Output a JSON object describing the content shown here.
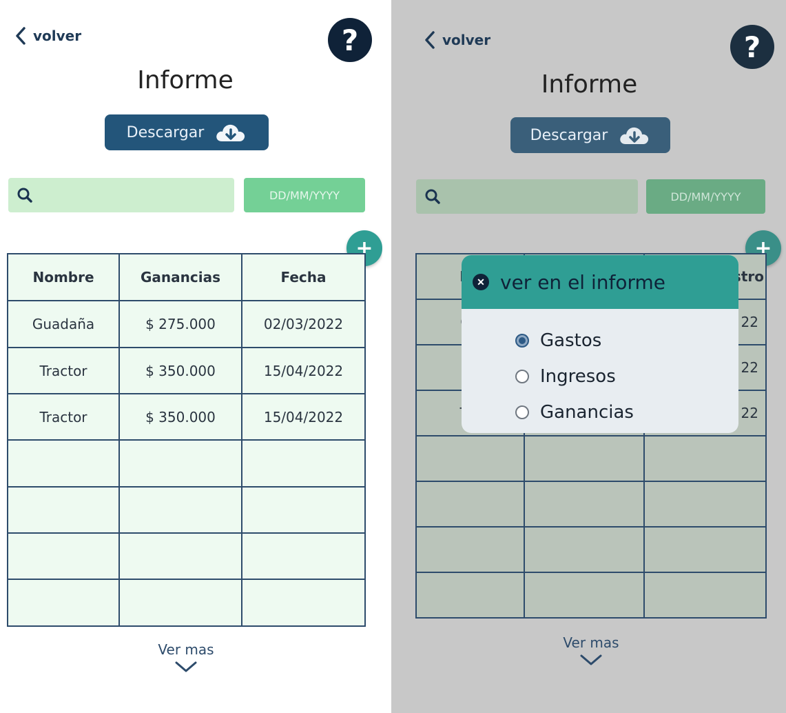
{
  "left": {
    "back_label": "volver",
    "help_label": "?",
    "title": "Informe",
    "download_label": "Descargar",
    "search_placeholder": "",
    "date_placeholder": "DD/MM/YYYY",
    "add_label": "+",
    "table": {
      "headers": [
        "Nombre",
        "Ganancias",
        "Fecha"
      ],
      "rows": [
        [
          "Guadaña",
          "$ 275.000",
          "02/03/2022"
        ],
        [
          "Tractor",
          "$ 350.000",
          "15/04/2022"
        ],
        [
          "Tractor",
          "$ 350.000",
          "15/04/2022"
        ],
        [
          "",
          "",
          ""
        ],
        [
          "",
          "",
          ""
        ],
        [
          "",
          "",
          ""
        ],
        [
          "",
          "",
          ""
        ]
      ]
    },
    "see_more_label": "Ver mas"
  },
  "right": {
    "back_label": "volver",
    "help_label": "?",
    "title": "Informe",
    "download_label": "Descargar",
    "search_placeholder": "",
    "date_placeholder": "DD/MM/YYYY",
    "add_label": "+",
    "table": {
      "headers": [
        "No",
        "",
        "stro"
      ],
      "rows": [
        [
          "Gu",
          "",
          "22"
        ],
        [
          "Tr",
          "",
          "22"
        ],
        [
          "Tra",
          "",
          "22"
        ],
        [
          "",
          "",
          ""
        ],
        [
          "",
          "",
          ""
        ],
        [
          "",
          "",
          ""
        ],
        [
          "",
          "",
          ""
        ]
      ]
    },
    "see_more_label": "Ver mas",
    "modal": {
      "title": "ver en el informe",
      "options": [
        {
          "label": "Gastos",
          "selected": true
        },
        {
          "label": "Ingresos",
          "selected": false
        },
        {
          "label": "Ganancias",
          "selected": false
        }
      ]
    }
  },
  "colors": {
    "navy": "#0f2238",
    "download_button": "#23557a",
    "search_bg": "#cdeecf",
    "date_bg": "#74d096",
    "accent_teal": "#2f9e94",
    "table_cell_bg": "#eefaf1",
    "overlay_gray": "#c8c8c8"
  },
  "icons": {
    "back": "chevron-left-icon",
    "help": "question-icon",
    "download": "cloud-download-icon",
    "search": "search-icon",
    "add": "plus-icon",
    "see_more": "chevron-down-icon",
    "close": "close-icon"
  }
}
